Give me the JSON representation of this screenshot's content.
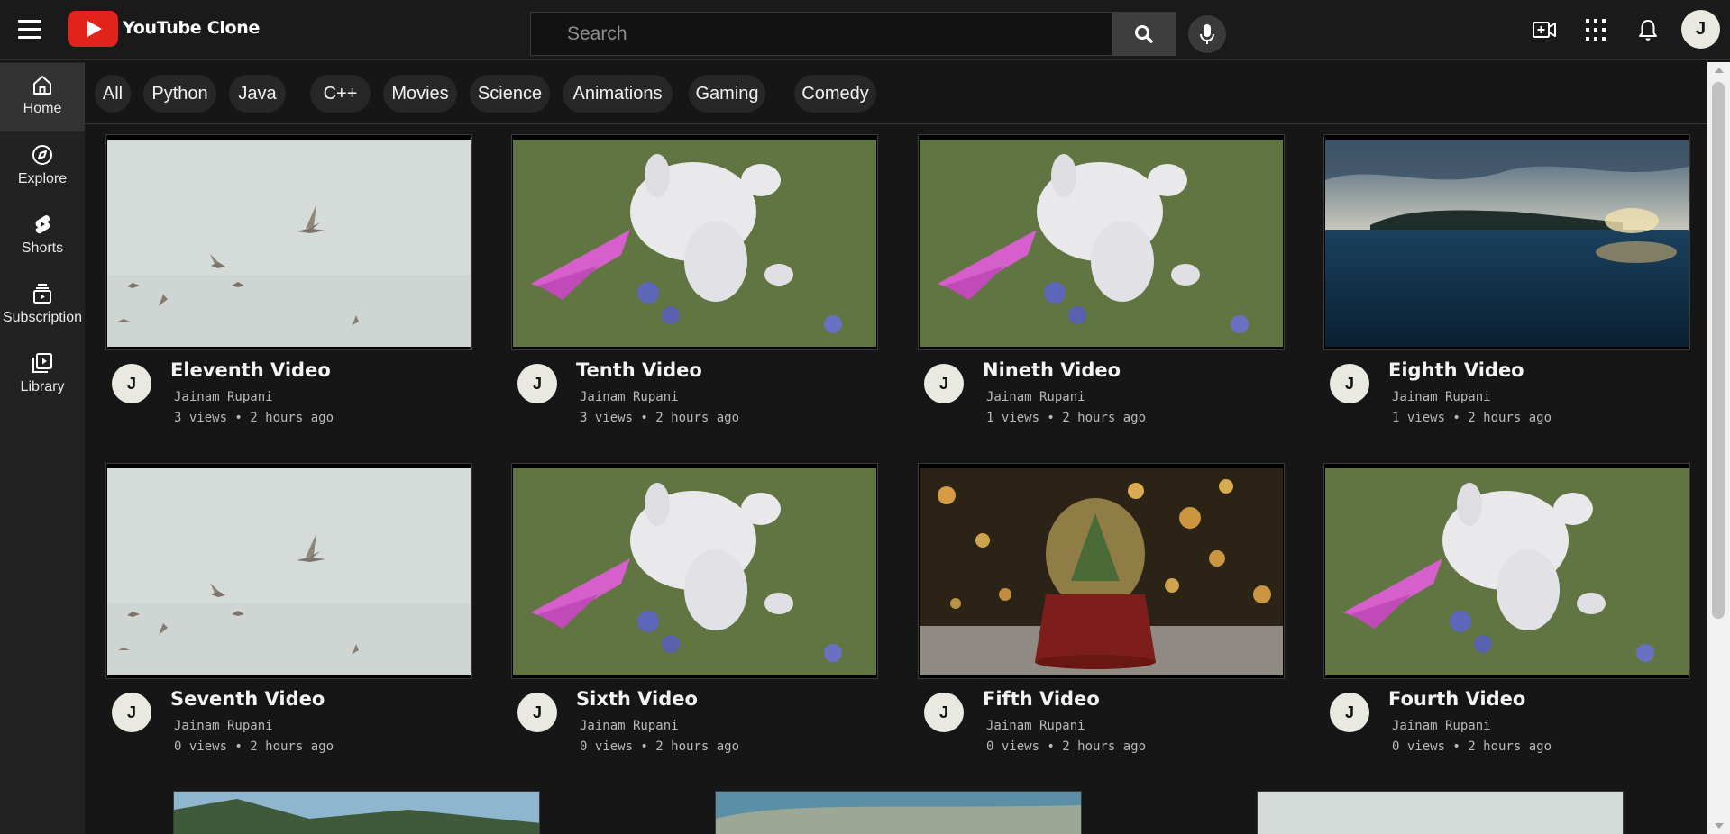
{
  "app": {
    "title": "YouTube Clone",
    "avatar_initial": "J"
  },
  "search": {
    "placeholder": "Search",
    "value": ""
  },
  "header_icons": [
    "video-create-icon",
    "apps-grid-icon",
    "bell-icon"
  ],
  "sidebar": {
    "items": [
      {
        "label": "Home",
        "icon": "home-icon",
        "active": true
      },
      {
        "label": "Explore",
        "icon": "compass-icon"
      },
      {
        "label": "Shorts",
        "icon": "shorts-icon"
      },
      {
        "label": "Subscription",
        "icon": "subscriptions-icon"
      },
      {
        "label": "Library",
        "icon": "library-icon"
      }
    ]
  },
  "chips": [
    "All",
    "Python",
    "Java",
    "C++",
    "Movies",
    "Science",
    "Animations",
    "Gaming",
    "Comedy"
  ],
  "videos": [
    {
      "title": "Eleventh Video",
      "channel": "Jainam Rupani",
      "meta": "3 views • 2 hours ago",
      "avatar": "J",
      "thumb": "birds"
    },
    {
      "title": "Tenth Video",
      "channel": "Jainam Rupani",
      "meta": "3 views • 2 hours ago",
      "avatar": "J",
      "thumb": "bunny"
    },
    {
      "title": "Nineth Video",
      "channel": "Jainam Rupani",
      "meta": "1 views • 2 hours ago",
      "avatar": "J",
      "thumb": "bunny"
    },
    {
      "title": "Eighth Video",
      "channel": "Jainam Rupani",
      "meta": "1 views • 2 hours ago",
      "avatar": "J",
      "thumb": "ocean"
    },
    {
      "title": "Seventh Video",
      "channel": "Jainam Rupani",
      "meta": "0 views • 2 hours ago",
      "avatar": "J",
      "thumb": "birds"
    },
    {
      "title": "Sixth Video",
      "channel": "Jainam Rupani",
      "meta": "0 views • 2 hours ago",
      "avatar": "J",
      "thumb": "bunny"
    },
    {
      "title": "Fifth Video",
      "channel": "Jainam Rupani",
      "meta": "0 views • 2 hours ago",
      "avatar": "J",
      "thumb": "snowglobe"
    },
    {
      "title": "Fourth Video",
      "channel": "Jainam Rupani",
      "meta": "0 views • 2 hours ago",
      "avatar": "J",
      "thumb": "bunny"
    }
  ],
  "colors": {
    "brand_red": "#e2231d",
    "background": "#161616",
    "sidebar": "#222222",
    "chip": "#272727",
    "avatar_bg": "#e9e9e1"
  }
}
